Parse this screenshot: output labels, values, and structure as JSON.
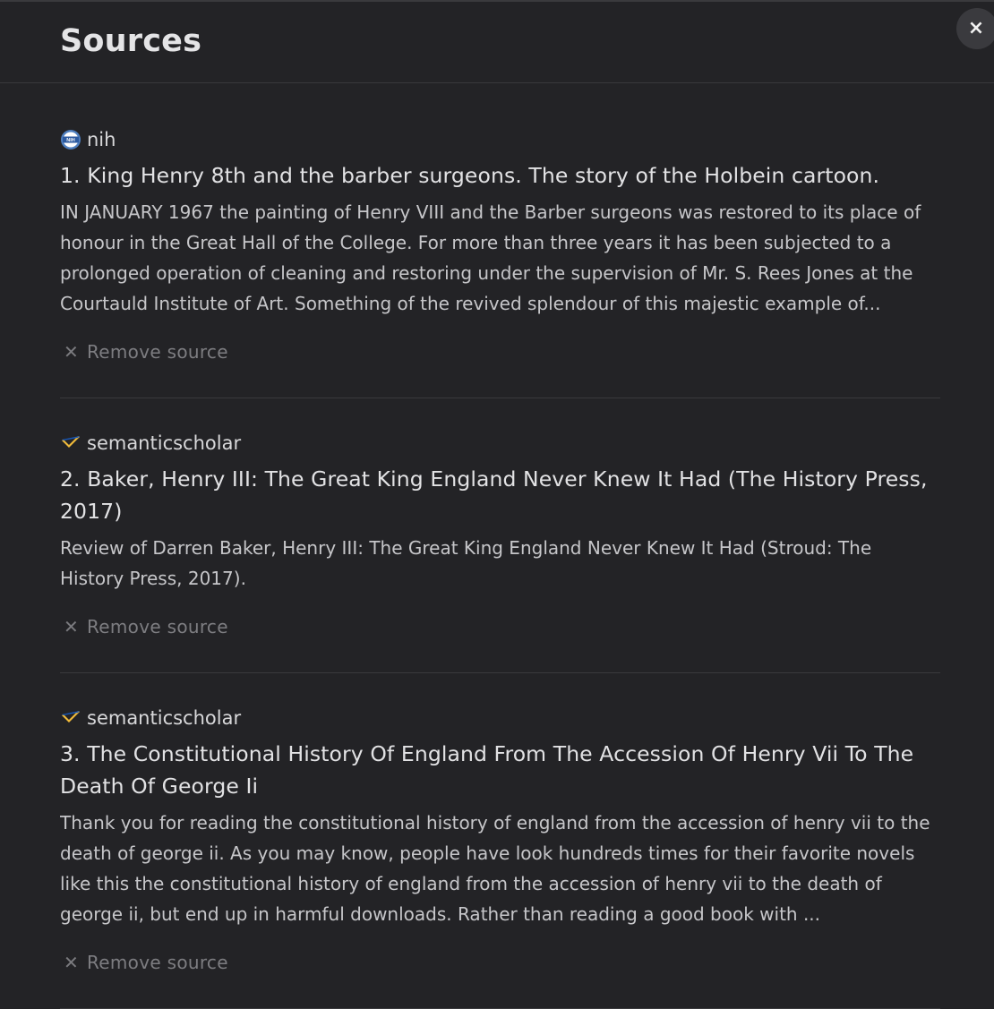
{
  "header": {
    "title": "Sources",
    "close_label": "×"
  },
  "items": [
    {
      "source": "nih",
      "source_icon": "nih-logo-icon",
      "title": "1. King Henry 8th and the barber surgeons. The story of the Holbein cartoon.",
      "description": "IN JANUARY 1967 the painting of Henry VIII and the Barber surgeons was restored to its place of honour in the Great Hall of the College. For more than three years it has been subjected to a prolonged operation of cleaning and restoring under the supervision of Mr. S. Rees Jones at the Courtauld Institute of Art. Something of the revived splendour of this majestic example of...",
      "remove_label": "Remove source"
    },
    {
      "source": "semanticscholar",
      "source_icon": "semanticscholar-logo-icon",
      "title": "2. Baker, Henry III: The Great King England Never Knew It Had (The History Press, 2017)",
      "description": "Review of Darren Baker, Henry III: The Great King England Never Knew It Had (Stroud: The History Press, 2017).",
      "remove_label": "Remove source"
    },
    {
      "source": "semanticscholar",
      "source_icon": "semanticscholar-logo-icon",
      "title": "3. The Constitutional History Of England From The Accession Of Henry Vii To The Death Of George Ii",
      "description": "Thank you for reading the constitutional history of england from the accession of henry vii to the death of george ii. As you may know, people have look hundreds times for their favorite novels like this the constitutional history of england from the accession of henry vii to the death of george ii, but end up in harmful downloads. Rather than reading a good book with ...",
      "remove_label": "Remove source"
    }
  ]
}
